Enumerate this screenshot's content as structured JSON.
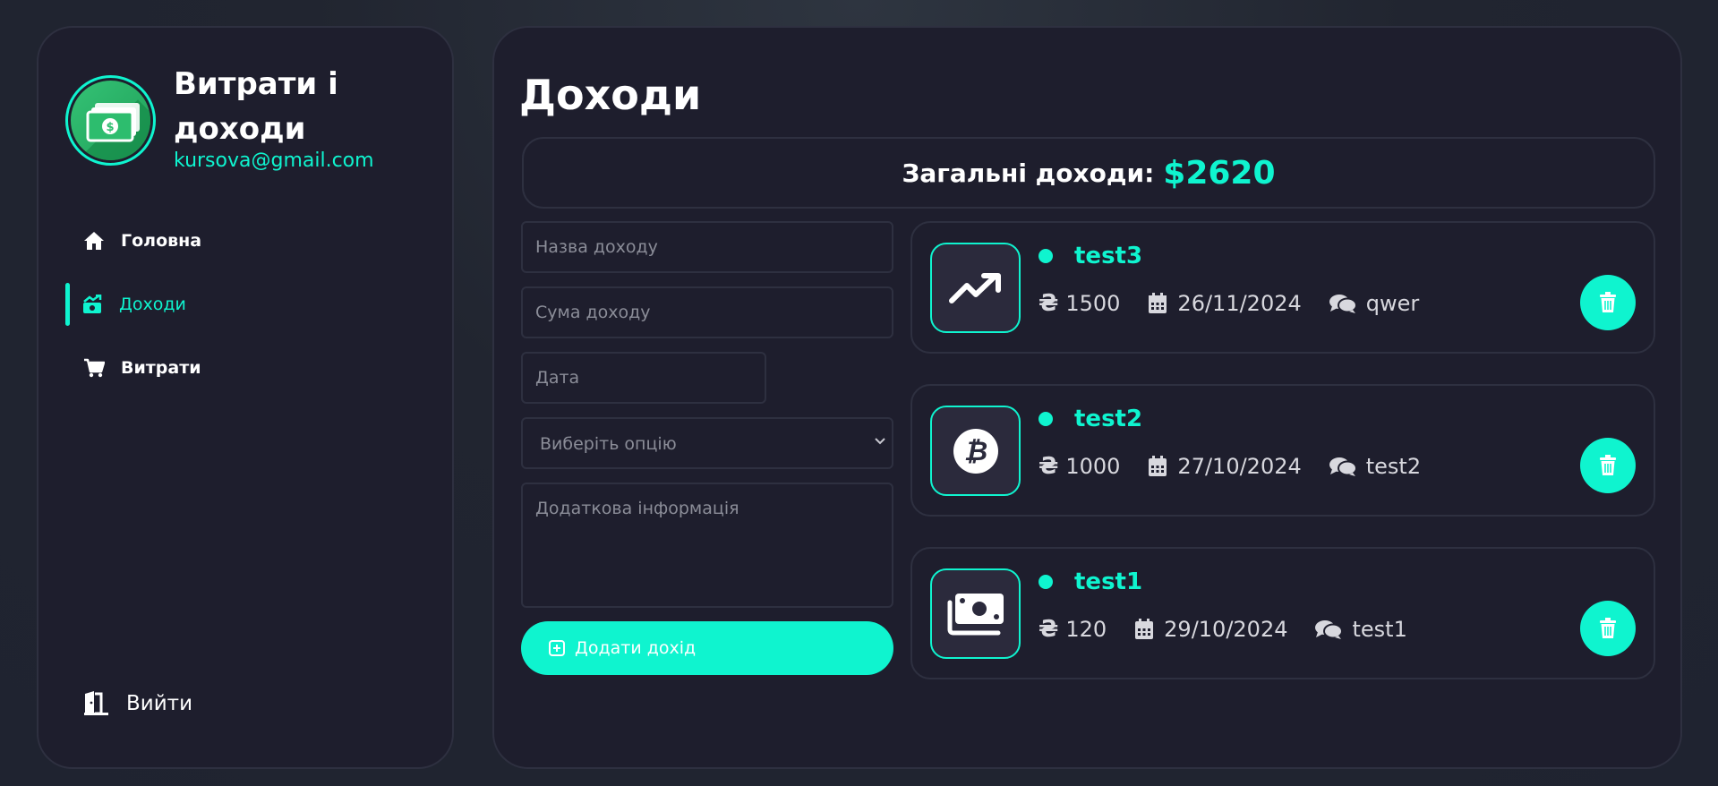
{
  "app": {
    "title": "Витрати і доходи",
    "email": "kursova@gmail.com"
  },
  "nav": {
    "items": [
      {
        "label": "Головна",
        "icon": "home-icon",
        "active": false
      },
      {
        "label": "Доходи",
        "icon": "money-bill-trend-icon",
        "active": true
      },
      {
        "label": "Витрати",
        "icon": "shopping-cart-icon",
        "active": false
      }
    ],
    "logout_label": "Вийти"
  },
  "main": {
    "title": "Доходи",
    "total_label": "Загальні доходи:",
    "total_value": "$2620"
  },
  "form": {
    "name_placeholder": "Назва доходу",
    "amount_placeholder": "Сума доходу",
    "date_placeholder": "Дата",
    "select_value": "Виберіть опцію",
    "info_placeholder": "Додаткова інформація",
    "submit_label": "Додати дохід"
  },
  "incomes": [
    {
      "title": "test3",
      "amount": "1500",
      "date": "26/11/2024",
      "comment": "qwer",
      "icon": "trend-up-icon"
    },
    {
      "title": "test2",
      "amount": "1000",
      "date": "27/10/2024",
      "comment": "test2",
      "icon": "bitcoin-icon"
    },
    {
      "title": "test1",
      "amount": "120",
      "date": "29/10/2024",
      "comment": "test1",
      "icon": "money-bills-icon"
    }
  ],
  "currency_symbol": "₴",
  "colors": {
    "accent": "#0ff4cf",
    "panel": "#1e1e2d",
    "border": "#2e3040",
    "icon_box": "#2b2a3c"
  }
}
